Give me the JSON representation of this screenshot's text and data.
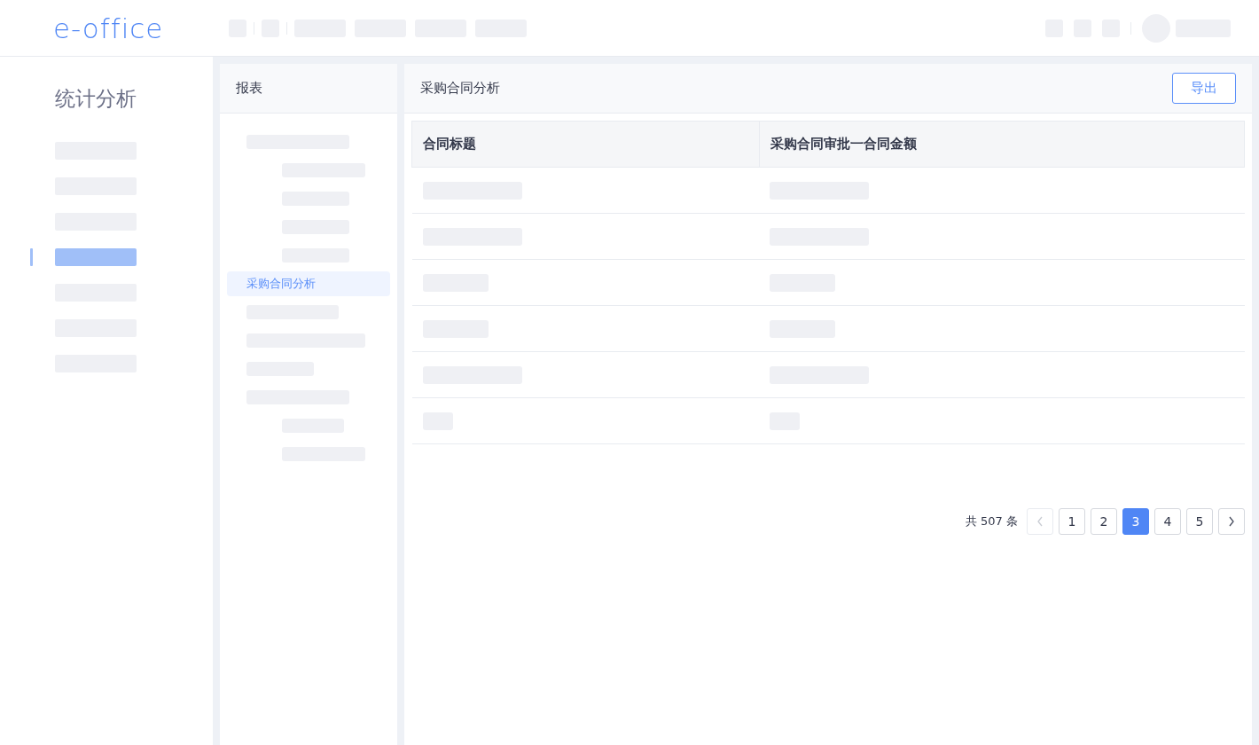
{
  "logo": {
    "text": "e-office"
  },
  "sidebar": {
    "title": "统计分析",
    "items": [
      {
        "selected": false
      },
      {
        "selected": false
      },
      {
        "selected": false
      },
      {
        "selected": true
      },
      {
        "selected": false
      },
      {
        "selected": false
      },
      {
        "selected": false
      }
    ]
  },
  "tree": {
    "title": "报表",
    "items": [
      {
        "selected": false,
        "children": [
          {
            "selected": false
          },
          {
            "selected": false
          },
          {
            "selected": false
          },
          {
            "selected": false
          }
        ]
      },
      {
        "label": "采购合同分析",
        "selected": true
      },
      {
        "selected": false
      },
      {
        "selected": false
      },
      {
        "selected": false
      },
      {
        "selected": false,
        "children": [
          {
            "selected": false
          },
          {
            "selected": false
          }
        ]
      }
    ]
  },
  "report": {
    "title": "采购合同分析",
    "export_button": "导出",
    "table": {
      "columns": [
        "合同标题",
        "采购合同审批一合同金额"
      ]
    },
    "pagination": {
      "total": "共 507 条",
      "prev": {
        "disabled": true
      },
      "next": {
        "disabled": false
      },
      "pages": [
        {
          "label": "1",
          "selected": false
        },
        {
          "label": "2",
          "selected": false
        },
        {
          "label": "3",
          "selected": true
        },
        {
          "label": "4",
          "selected": false
        },
        {
          "label": "5",
          "selected": false
        }
      ]
    }
  }
}
